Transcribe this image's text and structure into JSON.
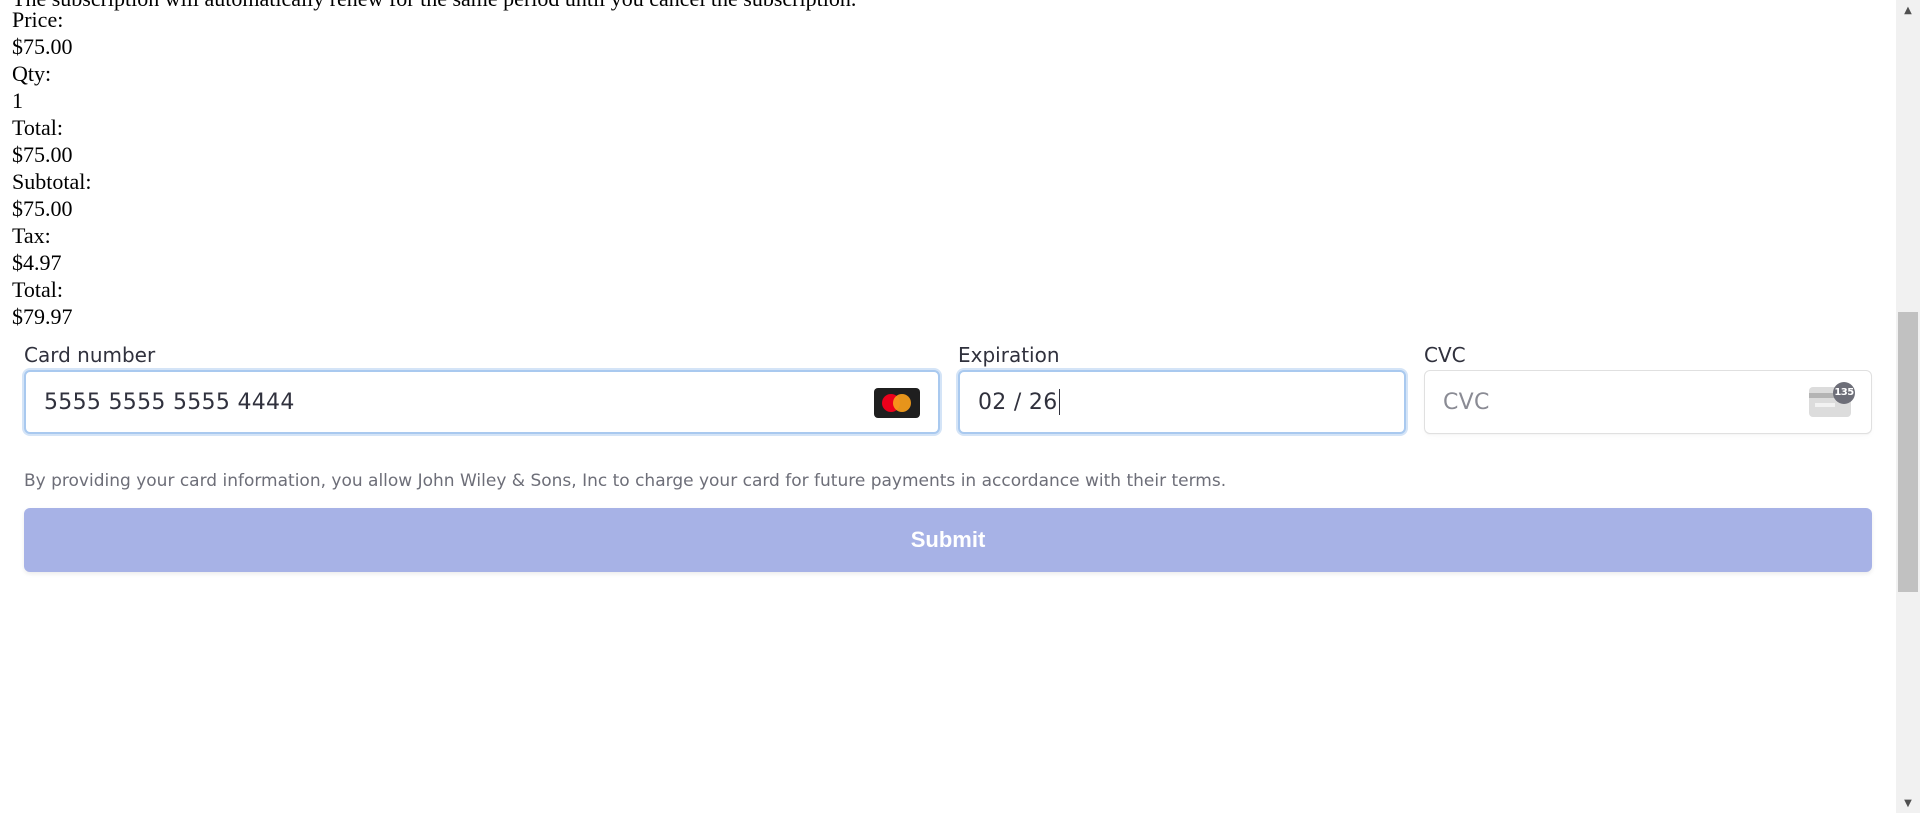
{
  "page": {
    "cut_off_line": "The subscription will automatically renew for the same period until you cancel the subscription."
  },
  "order_summary": {
    "price_label": "Price:",
    "price_value": "$75.00",
    "qty_label": "Qty:",
    "qty_value": "1",
    "line_total_label": "Total:",
    "line_total_value": "$75.00",
    "subtotal_label": "Subtotal:",
    "subtotal_value": "$75.00",
    "tax_label": "Tax:",
    "tax_value": "$4.97",
    "grand_total_label": "Total:",
    "grand_total_value": "$79.97"
  },
  "payment_form": {
    "card_number": {
      "label": "Card number",
      "value": "5555 5555 5555 4444",
      "brand_icon": "mastercard-icon"
    },
    "expiration": {
      "label": "Expiration",
      "value": "02 / 26"
    },
    "cvc": {
      "label": "CVC",
      "placeholder": "CVC",
      "icon": "cvc-card-icon",
      "icon_number": "135"
    },
    "terms_text": "By providing your card information, you allow John Wiley & Sons, Inc to charge your card for future payments in accordance with their terms.",
    "submit_label": "Submit"
  },
  "colors": {
    "submit_background": "#a7b2e6",
    "focus_border": "#a9c9ef",
    "text_primary": "#30313d",
    "text_secondary": "#6d6e78"
  }
}
